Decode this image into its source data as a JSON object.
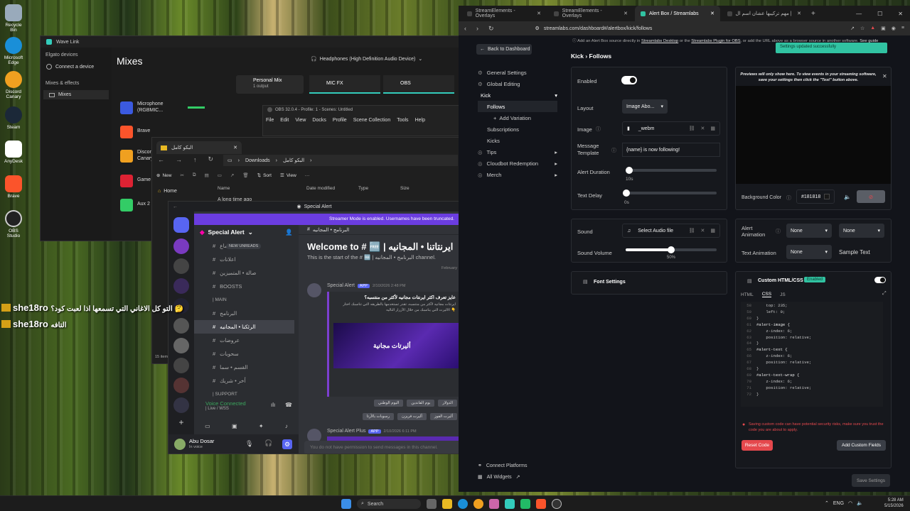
{
  "desktop": {
    "icons": [
      "Recycle Bin",
      "Microsoft Edge",
      "Discord Canary",
      "Steam",
      "AnyDesk",
      "Brave",
      "OBS Studio"
    ]
  },
  "chat_overlay": [
    {
      "user": "she18ro",
      "text": "التو كل الاغاني التي تسمعها اذا لعبت كود؟ 🤔"
    },
    {
      "user": "she18ro",
      "text": "التافه"
    }
  ],
  "wavelink": {
    "title": "Wave Link",
    "section_devices": "Elgato devices",
    "connect": "Connect a device",
    "section_mixes": "Mixes & effects",
    "mixes": "Mixes",
    "heading": "Mixes",
    "output_device": "Headphones (High Definition Audio Device)",
    "personal_mix": "Personal Mix",
    "personal_sub": "1 output",
    "mic_fx": "MIC FX",
    "obs": "OBS",
    "channels": [
      "Microphone (RGBMIC...",
      "Brave",
      "Discord Canary",
      "Game",
      "Aux 2"
    ]
  },
  "obs": {
    "title": "OBS 32.0.4 - Profile: 1 - Scenes: Untitled",
    "menu": [
      "File",
      "Edit",
      "View",
      "Docks",
      "Profile",
      "Scene Collection",
      "Tools",
      "Help"
    ]
  },
  "explorer": {
    "tab": "البكو كامل",
    "path": [
      "Downloads",
      "البكو كامل"
    ],
    "new": "New",
    "sort": "Sort",
    "view": "View",
    "home": "Home",
    "cols": [
      "Name",
      "Date modified",
      "Type",
      "Size"
    ],
    "row1": "A long time ago",
    "count": "15 items"
  },
  "discord": {
    "title": "Special Alert",
    "banner": "Streamer Mode is enabled. Usernames have been truncated.",
    "server": "Special Alert",
    "new_unreads": "NEW UNREADS",
    "channels": [
      "اجتماع",
      "اعلانات",
      "صالة • المتميزين",
      "BOOSTS",
      "| MAIN",
      "البرنامج",
      "الرئكنا • المجانيه",
      "عروضات",
      "سحوبات",
      "القسم • سما",
      "أخر • شريك",
      "| SUPPORT"
    ],
    "channel_header": "البرنامج • المجانيه",
    "welcome": "Welcome to # 🆓 | ايرنتاتنا • المجانيه",
    "start": "This is the start of the # 🆓 | البرنامج • المجانيه channel.",
    "date_div": "February",
    "bot1": "Special Alert",
    "app": "APP",
    "time1": "2/10/2026 2:48 PM",
    "msg_title": "عايز تعرف اكثر ايرنتات مجانيه لأكثر من منتسبه؟",
    "msg_body": "ايرنتات مجانيه لأكثر من منتسبه، تقدر تستخدمها بالطريقه التي تناسبك اختار الاليرت التي يناسبك من خلال الأزرار التاليه 👇",
    "embed_text": "أليرتات مجانية",
    "buttons": [
      "الدولار",
      "بوم الفاندين",
      "اليوم الوطني",
      "أليرت الفوز",
      "أليرت فريزن",
      "رسوبات بالأرتا"
    ],
    "bot2": "Special Alert Plus",
    "time2": "2/10/2026 6:11 PM",
    "voice": "Voice Connected",
    "voice_sub": "| Live / WSS",
    "user": "Abu Dosar",
    "user_sub": "In voice",
    "no_perm": "You do not have permission to send messages in this channel."
  },
  "browser": {
    "tabs": [
      "StreamElements - Overlays",
      "StreamElements - Overlays",
      "Alert Box / Streamlabs",
      "بيرمجة الأليرت | مهم تركيبها عشان اسم ال"
    ],
    "url": "streamlabs.com/dashboard#/alertbox/kick/follows"
  },
  "streamlabs": {
    "back": "Back to Dashboard",
    "info_pre": "Add an Alert Box source directly in",
    "info_l1": "Streamlabs Desktop",
    "info_mid": "or the",
    "info_l2": "Streamlabs Plugin for OBS",
    "info_post": ", or add the URL above as a browser source in another software.",
    "info_guide": "See guide",
    "toast": "Settings updated successfully",
    "nav": [
      "General Settings",
      "Global Editing",
      "Kick",
      "Follows",
      "Add Variation",
      "Subscriptions",
      "Kicks",
      "Tips",
      "Cloudbot Redemption",
      "Merch"
    ],
    "crumb": "Kick › Follows",
    "enabled": "Enabled",
    "layout": "Layout",
    "layout_val": "Image Abo...",
    "image": "Image",
    "image_val": "_webm",
    "msg_template": "Message Template",
    "msg_val": "{name} is now following!",
    "alert_duration": "Alert Duration",
    "dur_val": "10s",
    "text_delay": "Text Delay",
    "delay_val": "0s",
    "preview_note": "Previews will only show here. To view events in your streaming software, save your settings then click the \"Test\" button above.",
    "bg_color": "Background Color",
    "bg_val": "#181818",
    "sound": "Sound",
    "sound_val": "Select Audio file",
    "sound_vol": "Sound Volume",
    "vol_val": "50%",
    "alert_anim": "Alert Animation",
    "text_anim": "Text Animation",
    "none": "None",
    "sample": "Sample Text",
    "font_settings": "Font Settings",
    "custom": "Custom HTML/CSS",
    "custom_badge": "Enabled",
    "code_tabs": [
      "HTML",
      "CSS",
      "JS"
    ],
    "code_lines": [
      "    top: 235;",
      "    left: 0;",
      "}",
      "#alert-image {",
      "    z-index: 6;",
      "    position: relative;",
      "}",
      "#alert-text {",
      "    z-index: 6;",
      "    position: relative;",
      "}",
      "#alert-text-wrap {",
      "    z-index: 6;",
      "    position: relative;",
      "}"
    ],
    "line_nums": [
      "58",
      "59",
      "60",
      "61",
      "62",
      "63",
      "64",
      "65",
      "66",
      "67",
      "68",
      "69",
      "70",
      "71",
      "72"
    ],
    "warn": "Saving custom code can have potential security risks, make sure you trust the code you are about to apply.",
    "reset": "Reset Code",
    "add_fields": "Add Custom Fields",
    "connect": "Connect Platforms",
    "widgets": "All Widgets",
    "save": "Save Settings"
  },
  "taskbar": {
    "search": "Search",
    "lang": "ENG",
    "time": "5:28 AM",
    "date": "5/15/2026"
  },
  "colors": {
    "accent": "#31c3a2",
    "discord_purple": "#5865f2",
    "red": "#e5484d",
    "wavelink_bg": "#1c1c1c"
  }
}
